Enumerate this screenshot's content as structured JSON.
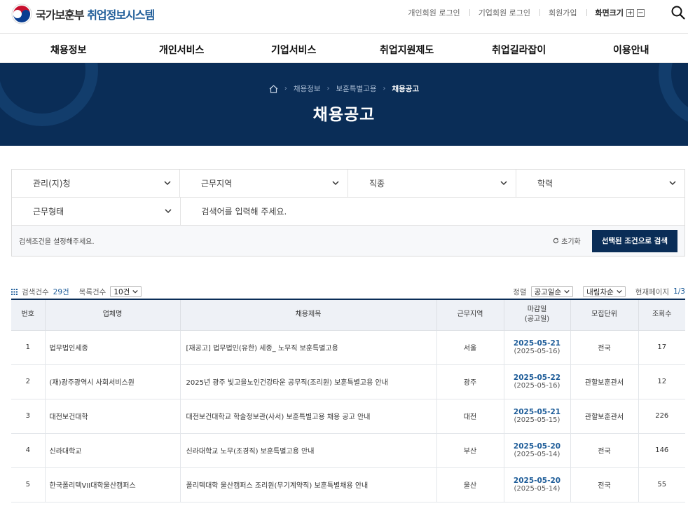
{
  "header": {
    "logo_main": "국가보훈부",
    "logo_accent": "취업정보시스템",
    "util": [
      "개인회원 로그인",
      "기업회원 로그인",
      "회원가입"
    ],
    "zoom_label": "화면크기",
    "zoom_in": "+",
    "zoom_out": "−"
  },
  "nav": [
    "채용정보",
    "개인서비스",
    "기업서비스",
    "취업지원제도",
    "취업길라잡이",
    "이용안내"
  ],
  "breadcrumb": [
    "채용정보",
    "보훈특별고용",
    "채용공고"
  ],
  "page_title": "채용공고",
  "filters": {
    "row1": [
      "관리(지)청",
      "근무지역",
      "직종",
      "학력"
    ],
    "employment_type": "근무형태",
    "search_text": "검색어를 입력해 주세요.",
    "hint": "검색조건을 설정해주세요.",
    "reset": "초기화",
    "apply": "선택된 조건으로 검색"
  },
  "listbar": {
    "count_label": "검색건수",
    "count": "29건",
    "per_page_label": "목록건수",
    "per_page": "10건",
    "sort_label": "정렬",
    "sort": "공고일순",
    "order": "내림차순",
    "page_label": "현재페이지",
    "page": "1/3"
  },
  "table": {
    "headers": [
      "번호",
      "업체명",
      "채용제목",
      "근무지역",
      "마감일",
      "(공고일)",
      "모집단위",
      "조회수"
    ],
    "rows": [
      {
        "no": "1",
        "company": "법무법인세종",
        "title": "[재공고] 법무법인(유한) 세종_ 노무직 보훈특별고용",
        "region": "서울",
        "deadline": "2025-05-21",
        "posted": "(2025-05-16)",
        "unit": "전국",
        "views": "17"
      },
      {
        "no": "2",
        "company": "(재)광주광역시 사회서비스원",
        "title": "2025년 광주 빛고을노인건강타운 공무직(조리원) 보훈특별고용 안내",
        "region": "광주",
        "deadline": "2025-05-22",
        "posted": "(2025-05-16)",
        "unit": "관할보훈관서",
        "views": "12"
      },
      {
        "no": "3",
        "company": "대전보건대학",
        "title": "대전보건대학교 학술정보관(사서) 보훈특별고용 채용 공고 안내",
        "region": "대전",
        "deadline": "2025-05-21",
        "posted": "(2025-05-15)",
        "unit": "관할보훈관서",
        "views": "226"
      },
      {
        "no": "4",
        "company": "신라대학교",
        "title": "신라대학교 노무(조경직) 보훈특별고용 안내",
        "region": "부산",
        "deadline": "2025-05-20",
        "posted": "(2025-05-14)",
        "unit": "전국",
        "views": "146"
      },
      {
        "no": "5",
        "company": "한국폴리텍VII대학울산캠퍼스",
        "title": "폴리텍대학 울산캠퍼스 조리원(무기계약직) 보훈특별채용 안내",
        "region": "울산",
        "deadline": "2025-05-20",
        "posted": "(2025-05-14)",
        "unit": "전국",
        "views": "55"
      }
    ]
  }
}
